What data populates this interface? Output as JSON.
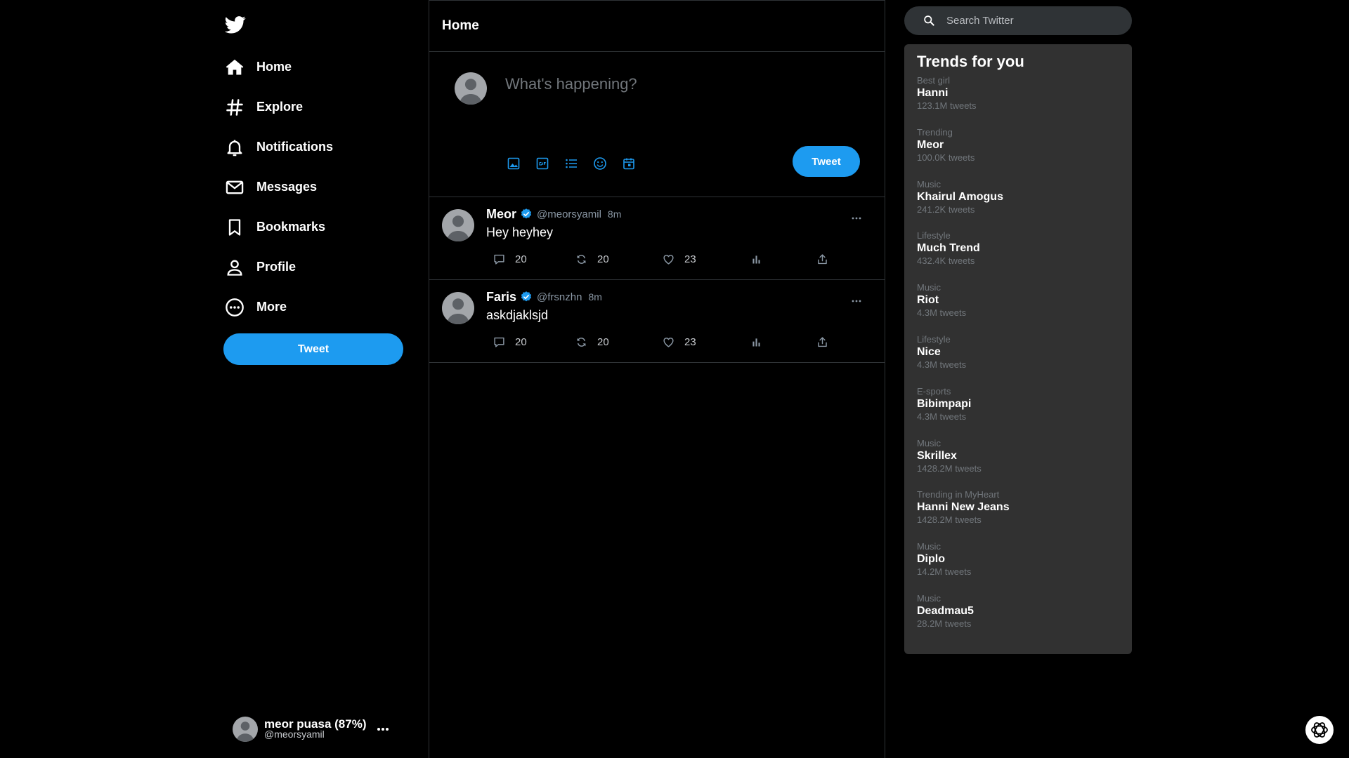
{
  "sidebar": {
    "logo": "twitter-bird-icon",
    "nav": [
      {
        "label": "Home",
        "icon": "home-icon"
      },
      {
        "label": "Explore",
        "icon": "hashtag-icon"
      },
      {
        "label": "Notifications",
        "icon": "bell-icon"
      },
      {
        "label": "Messages",
        "icon": "envelope-icon"
      },
      {
        "label": "Bookmarks",
        "icon": "bookmark-icon"
      },
      {
        "label": "Profile",
        "icon": "person-icon"
      },
      {
        "label": "More",
        "icon": "more-circle-icon"
      }
    ],
    "tweet_button": "Tweet",
    "account": {
      "name": "meor puasa (87%)",
      "handle": "@meorsyamil"
    }
  },
  "main": {
    "title": "Home",
    "composer": {
      "placeholder": "What's happening?",
      "tools": [
        "image-icon",
        "gif-icon",
        "poll-icon",
        "emoji-icon",
        "schedule-icon"
      ],
      "tweet_button": "Tweet"
    },
    "tweets": [
      {
        "name": "Meor",
        "handle": "@meorsyamil",
        "time": "8m",
        "text": "Hey heyhey",
        "replies": "20",
        "retweets": "20",
        "likes": "23"
      },
      {
        "name": "Faris",
        "handle": "@frsnzhn",
        "time": "8m",
        "text": "askdjaklsjd",
        "replies": "20",
        "retweets": "20",
        "likes": "23"
      }
    ]
  },
  "right": {
    "search": {
      "placeholder": "Search Twitter"
    },
    "trends_title": "Trends for you",
    "trends": [
      {
        "category": "Best girl",
        "name": "Hanni",
        "count": "123.1M tweets"
      },
      {
        "category": "Trending",
        "name": "Meor",
        "count": "100.0K tweets"
      },
      {
        "category": "Music",
        "name": "Khairul Amogus",
        "count": "241.2K tweets"
      },
      {
        "category": "Lifestyle",
        "name": "Much Trend",
        "count": "432.4K tweets"
      },
      {
        "category": "Music",
        "name": "Riot",
        "count": "4.3M tweets"
      },
      {
        "category": "Lifestyle",
        "name": "Nice",
        "count": "4.3M tweets"
      },
      {
        "category": "E-sports",
        "name": "Bibimpapi",
        "count": "4.3M tweets"
      },
      {
        "category": "Music",
        "name": "Skrillex",
        "count": "1428.2M tweets"
      },
      {
        "category": "Trending in MyHeart",
        "name": "Hanni New Jeans",
        "count": "1428.2M tweets"
      },
      {
        "category": "Music",
        "name": "Diplo",
        "count": "14.2M tweets"
      },
      {
        "category": "Music",
        "name": "Deadmau5",
        "count": "28.2M tweets"
      }
    ]
  },
  "colors": {
    "accent": "#1d9bf0",
    "background": "#000000",
    "panel": "#313131",
    "muted": "#71767b"
  }
}
